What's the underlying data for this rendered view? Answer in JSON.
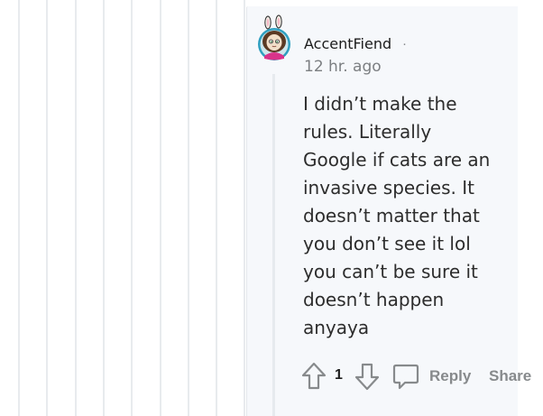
{
  "comment": {
    "author": "AccentFiend",
    "separator": "·",
    "timestamp": "12 hr. ago",
    "body_lines": [
      "I didn’t make the",
      "rules. Literally",
      "Google if cats are an",
      "invasive species. It",
      "doesn’t matter that",
      "you don’t see it lol",
      "you can’t be sure it",
      "doesn’t happen",
      "anyaya"
    ],
    "avatar_icon": "avatar-icon"
  },
  "actions": {
    "vote_count": "1",
    "upvote_icon": "upvote-arrow-icon",
    "downvote_icon": "downvote-arrow-icon",
    "reply_icon": "comment-bubble-icon",
    "reply_label": "Reply",
    "share_label": "Share"
  },
  "colors": {
    "panel_background": "#f6f8fb",
    "thread_line": "#e8ebee",
    "text_primary": "#2d2d2d",
    "text_secondary": "#878a8c"
  }
}
